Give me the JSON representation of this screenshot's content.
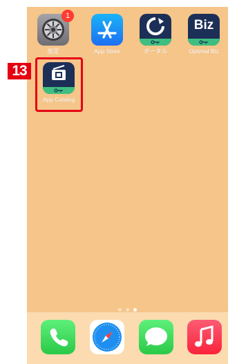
{
  "home_screen": {
    "apps": [
      {
        "label": "設定",
        "icon": "settings-gear-icon",
        "badge": "1"
      },
      {
        "label": "App Store",
        "icon": "app-store-icon"
      },
      {
        "label": "ポータル",
        "icon": "portal-icon"
      },
      {
        "label": "Optimal Biz",
        "icon": "optimal-biz-icon",
        "icon_text": "Biz"
      },
      {
        "label": "App Catalog",
        "icon": "app-catalog-icon"
      }
    ],
    "page_indicator": {
      "pages": 3,
      "current": 3
    },
    "dock": [
      {
        "icon": "phone-icon"
      },
      {
        "icon": "safari-icon"
      },
      {
        "icon": "messages-icon"
      },
      {
        "icon": "music-icon"
      }
    ]
  },
  "annotation": {
    "step_number": "13",
    "color": "#e50012"
  },
  "colors": {
    "wallpaper": "#f5c58a",
    "key_strip": "#3fbf7f",
    "badge": "#ff3b30"
  }
}
